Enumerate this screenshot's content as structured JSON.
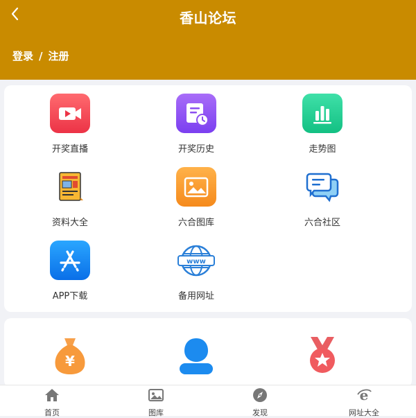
{
  "header": {
    "title": "香山论坛",
    "back_icon": "chevron-left-icon",
    "login": "登录",
    "separator": "/",
    "register": "注册",
    "bg_color": "#c98b00"
  },
  "menu": {
    "items": [
      {
        "label": "开奖直播",
        "icon": "video-play-icon",
        "color": "#f04a55"
      },
      {
        "label": "开奖历史",
        "icon": "history-document-icon",
        "color": "#8b4ef0"
      },
      {
        "label": "走势图",
        "icon": "bar-chart-icon",
        "color": "#1fcf93"
      },
      {
        "label": "资料大全",
        "icon": "newspaper-icon",
        "color": "#f3a21c"
      },
      {
        "label": "六合图库",
        "icon": "image-gallery-icon",
        "color": "#f79a2a"
      },
      {
        "label": "六合社区",
        "icon": "chat-bubbles-icon",
        "color": "#2b7fe0"
      },
      {
        "label": "APP下载",
        "icon": "app-store-icon",
        "color": "#1683f0"
      },
      {
        "label": "备用网址",
        "icon": "globe-www-icon",
        "color": "#2a7fd8"
      }
    ]
  },
  "second_card": {
    "icons": [
      "money-bag-icon",
      "user-avatar-icon",
      "medal-icon"
    ]
  },
  "tabbar": {
    "items": [
      {
        "label": "首页",
        "icon": "home-icon"
      },
      {
        "label": "图库",
        "icon": "image-icon"
      },
      {
        "label": "发现",
        "icon": "compass-icon"
      },
      {
        "label": "网址大全",
        "icon": "ie-browser-icon"
      }
    ]
  }
}
